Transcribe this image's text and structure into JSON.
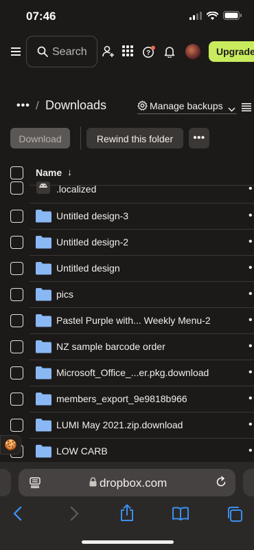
{
  "status_bar": {
    "time": "07:46",
    "icons": [
      "signal-icon",
      "wifi-icon",
      "battery-icon"
    ]
  },
  "topbar": {
    "search_placeholder": "Search",
    "icons": [
      "menu-icon",
      "search-icon",
      "add-user-icon",
      "apps-grid-icon",
      "help-icon",
      "bell-icon"
    ],
    "upgrade_label": "Upgrade",
    "help_badge_color": "#f06a4e",
    "upgrade_color": "#c9ec5e"
  },
  "breadcrumb": {
    "more": "•••",
    "separator": "/",
    "title": "Downloads",
    "manage_backups": "Manage backups"
  },
  "actions": {
    "download": "Download",
    "rewind": "Rewind this folder",
    "more": "•••"
  },
  "table": {
    "header_name": "Name",
    "sort_arrow": "↓",
    "rows": [
      {
        "name": ".localized",
        "type": "file"
      },
      {
        "name": "Untitled design-3",
        "type": "folder"
      },
      {
        "name": "Untitled design-2",
        "type": "folder"
      },
      {
        "name": "Untitled design",
        "type": "folder"
      },
      {
        "name": "pics",
        "type": "folder"
      },
      {
        "name": "Pastel Purple with... Weekly Menu-2",
        "type": "folder"
      },
      {
        "name": "NZ sample barcode order",
        "type": "folder"
      },
      {
        "name": "Microsoft_Office_...er.pkg.download",
        "type": "folder"
      },
      {
        "name": "members_export_9e9818b966",
        "type": "folder"
      },
      {
        "name": "LUMI May 2021.zip.download",
        "type": "folder"
      },
      {
        "name": "LOW CARB",
        "type": "folder"
      }
    ],
    "row_more": "•"
  },
  "cookie": {
    "glyph": "🍪"
  },
  "safari": {
    "url": "dropbox.com",
    "nav": [
      "back-icon",
      "forward-icon",
      "share-icon",
      "bookmarks-icon",
      "tabs-icon"
    ]
  },
  "colors": {
    "background": "#1c1a19",
    "folder": "#8ab8f5",
    "accent_blue": "#3b8ff0"
  }
}
